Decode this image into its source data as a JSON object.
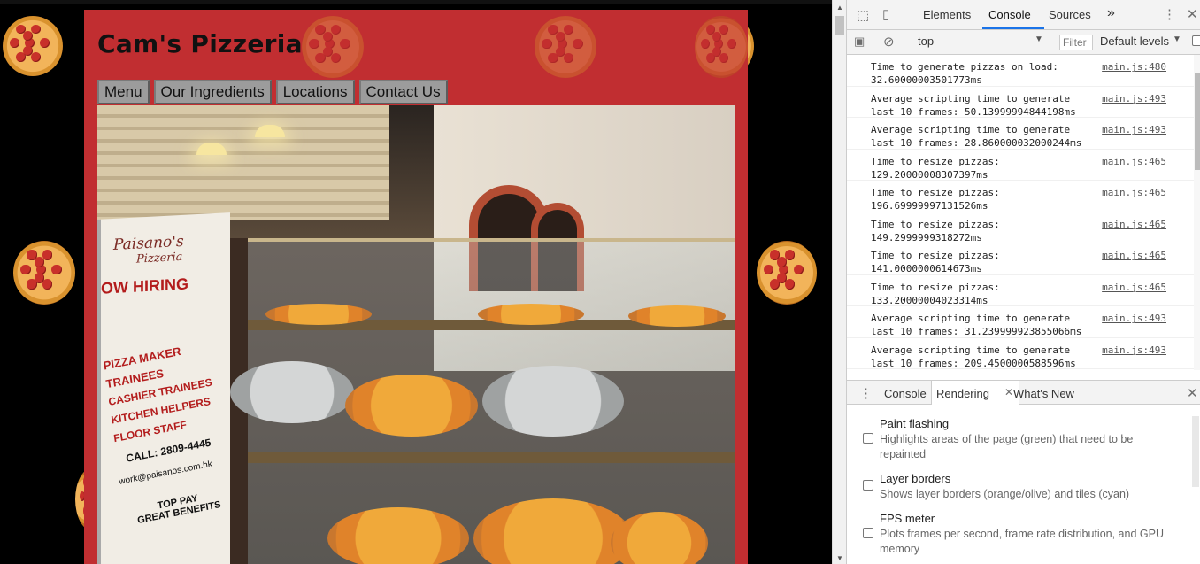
{
  "site": {
    "title": "Cam's Pizzeria",
    "nav": [
      "Menu",
      "Our Ingredients",
      "Locations",
      "Contact Us"
    ],
    "banner": {
      "brand": "Paisano's",
      "sub": "Pizzeria",
      "hiring": "OW HIRING",
      "list": [
        "PIZZA MAKER",
        "TRAINEES",
        "CASHIER TRAINEES",
        "KITCHEN HELPERS",
        "FLOOR STAFF"
      ],
      "call": "CALL: 2809-4445",
      "email": "work@paisanos.com.hk",
      "pay1": "TOP PAY",
      "pay2": "GREAT BENEFITS"
    }
  },
  "devtools": {
    "tabs": [
      "Elements",
      "Console",
      "Sources"
    ],
    "active_tab": "Console",
    "more_tabs": "»",
    "context": "top",
    "filter_placeholder": "Filter",
    "levels": "Default levels",
    "messages": [
      {
        "line1": "Time to generate pizzas on load:",
        "line2": "32.60000003501773ms",
        "src": "main.js:480"
      },
      {
        "line1": "Average scripting time to generate",
        "line2": "last 10 frames: 50.13999994844198ms",
        "src": "main.js:493"
      },
      {
        "line1": "Average scripting time to generate",
        "line2": "last 10 frames: 28.860000032000244ms",
        "src": "main.js:493"
      },
      {
        "line1": "Time to resize pizzas:",
        "line2": "129.20000008307397ms",
        "src": "main.js:465"
      },
      {
        "line1": "Time to resize pizzas:",
        "line2": "196.69999997131526ms",
        "src": "main.js:465"
      },
      {
        "line1": "Time to resize pizzas:",
        "line2": "149.2999999318272ms",
        "src": "main.js:465"
      },
      {
        "line1": "Time to resize pizzas:",
        "line2": "141.0000000614673ms",
        "src": "main.js:465"
      },
      {
        "line1": "Time to resize pizzas:",
        "line2": "133.20000004023314ms",
        "src": "main.js:465"
      },
      {
        "line1": "Average scripting time to generate",
        "line2": "last 10 frames: 31.239999923855066ms",
        "src": "main.js:493"
      },
      {
        "line1": "Average scripting time to generate",
        "line2": "last 10 frames: 209.4500000588596ms",
        "src": "main.js:493"
      }
    ],
    "drawer": {
      "tabs": [
        "Console",
        "Rendering",
        "What's New"
      ],
      "active_tab": "Rendering",
      "options": [
        {
          "title": "Paint flashing",
          "desc": "Highlights areas of the page (green) that need to be repainted",
          "checked": false
        },
        {
          "title": "Layer borders",
          "desc": "Shows layer borders (orange/olive) and tiles (cyan)",
          "checked": false
        },
        {
          "title": "FPS meter",
          "desc": "Plots frames per second, frame rate distribution, and GPU memory",
          "checked": false
        }
      ]
    }
  },
  "colors": {
    "container": "#c12e31",
    "nav_button": "#9c9c9c",
    "devtools_accent": "#1a73e8"
  }
}
